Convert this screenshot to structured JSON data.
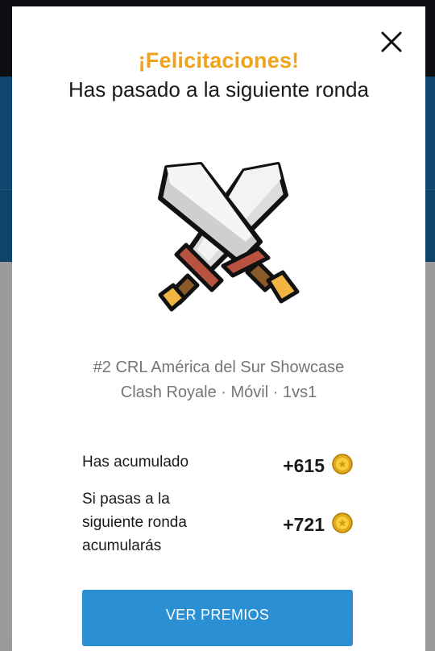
{
  "modal": {
    "title": "¡Felicitaciones!",
    "subtitle": "Has pasado a la siguiente ronda",
    "event_name": "#2 CRL América del Sur Showcase",
    "event_meta": "Clash Royale · Móvil · 1vs1",
    "rows": [
      {
        "label": "Has acumulado",
        "amount": "+615",
        "icon": "coin-icon"
      },
      {
        "label": "Si pasas a la siguiente ronda acumularás",
        "amount": "+721",
        "icon": "coin-icon"
      }
    ],
    "primary_button": "VER PREMIOS",
    "close_icon": "close-icon",
    "illustration": "crossed-swords-icon"
  },
  "colors": {
    "accent_title": "#efa21a",
    "button": "#2b8fd4",
    "coin": "#f2c12e"
  }
}
